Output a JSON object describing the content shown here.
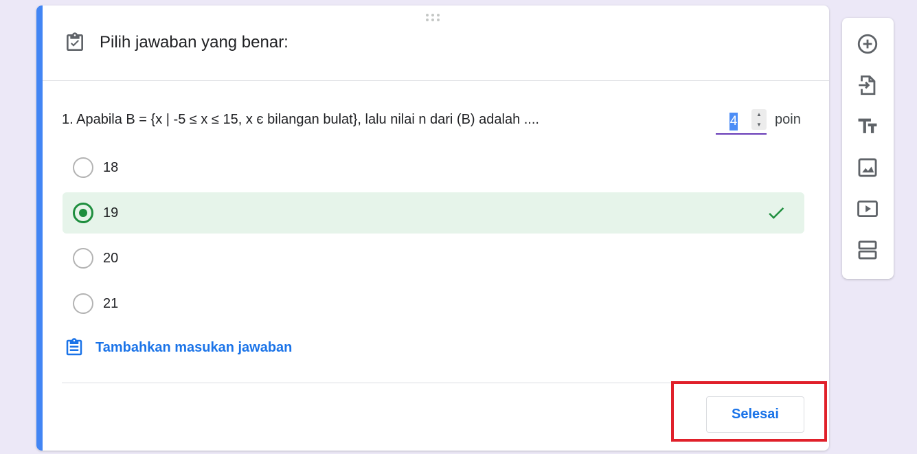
{
  "card": {
    "title": "Pilih jawaban yang benar:",
    "title_icon": "assignment-check-icon",
    "accent_color": "#4285f4"
  },
  "question": {
    "text": "1. Apabila B = {x | -5 ≤ x ≤ 15, x є bilangan bulat}, lalu nilai n dari (B) adalah ....",
    "points_value": "4",
    "points_label": "poin"
  },
  "options": [
    {
      "label": "18",
      "correct": false
    },
    {
      "label": "19",
      "correct": true
    },
    {
      "label": "20",
      "correct": false
    },
    {
      "label": "21",
      "correct": false
    }
  ],
  "add_answer": {
    "label": "Tambahkan masukan jawaban",
    "icon": "clipboard-feedback-icon"
  },
  "footer": {
    "done_label": "Selesai"
  },
  "colors": {
    "correct_green": "#1e8e3e",
    "correct_bg": "#e6f4ea",
    "link_blue": "#1a73e8",
    "highlight_red": "#e0202a"
  },
  "toolbar": {
    "tools": [
      {
        "name": "add-question",
        "icon": "add-circle-icon"
      },
      {
        "name": "import-questions",
        "icon": "import-icon"
      },
      {
        "name": "add-title-description",
        "icon": "title-text-icon"
      },
      {
        "name": "add-image",
        "icon": "image-icon"
      },
      {
        "name": "add-video",
        "icon": "video-icon"
      },
      {
        "name": "add-section",
        "icon": "section-icon"
      }
    ]
  }
}
